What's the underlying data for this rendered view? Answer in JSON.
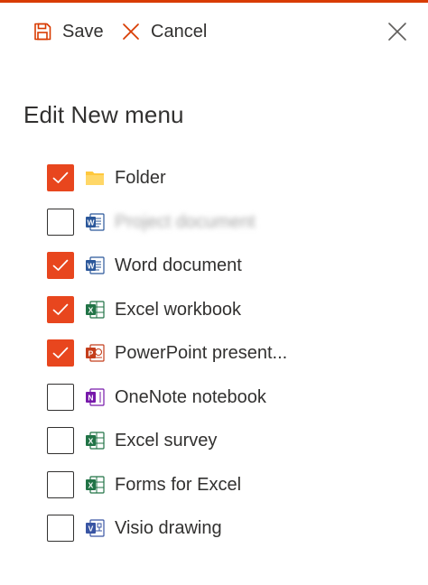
{
  "toolbar": {
    "save_label": "Save",
    "cancel_label": "Cancel"
  },
  "panel": {
    "title": "Edit New menu"
  },
  "colors": {
    "accent": "#e8461e",
    "word": "#2b579a",
    "excel": "#217346",
    "powerpoint": "#c43e1c",
    "onenote": "#7719aa",
    "visio": "#3955a3",
    "folder": "#ffc83d"
  },
  "items": [
    {
      "label": "Folder",
      "checked": true,
      "icon": "folder-icon"
    },
    {
      "label": "Project document",
      "checked": false,
      "icon": "word-icon",
      "blurred": true
    },
    {
      "label": "Word document",
      "checked": true,
      "icon": "word-icon"
    },
    {
      "label": "Excel workbook",
      "checked": true,
      "icon": "excel-icon"
    },
    {
      "label": "PowerPoint present...",
      "checked": true,
      "icon": "powerpoint-icon"
    },
    {
      "label": "OneNote notebook",
      "checked": false,
      "icon": "onenote-icon"
    },
    {
      "label": "Excel survey",
      "checked": false,
      "icon": "excel-icon"
    },
    {
      "label": "Forms for Excel",
      "checked": false,
      "icon": "excel-icon"
    },
    {
      "label": "Visio drawing",
      "checked": false,
      "icon": "visio-icon"
    }
  ]
}
